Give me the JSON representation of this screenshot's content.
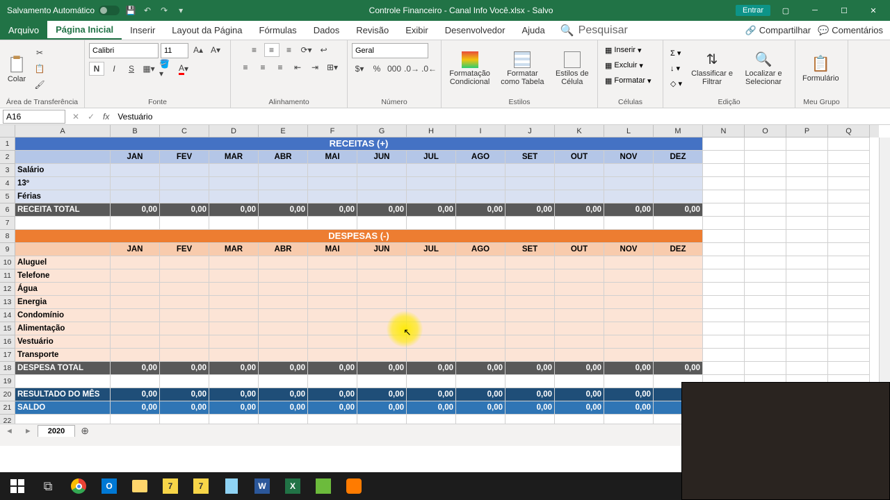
{
  "titlebar": {
    "auto_save": "Salvamento Automático",
    "title": "Controle Financeiro - Canal Info Você.xlsx - Salvo",
    "login": "Entrar"
  },
  "tabs": {
    "file": "Arquivo",
    "home": "Página Inicial",
    "insert": "Inserir",
    "layout": "Layout da Página",
    "formulas": "Fórmulas",
    "data": "Dados",
    "review": "Revisão",
    "view": "Exibir",
    "developer": "Desenvolvedor",
    "help": "Ajuda",
    "search": "Pesquisar",
    "share": "Compartilhar",
    "comments": "Comentários"
  },
  "ribbon": {
    "clipboard": {
      "paste": "Colar",
      "label": "Área de Transferência"
    },
    "font": {
      "name": "Calibri",
      "size": "11",
      "label": "Fonte"
    },
    "alignment": {
      "label": "Alinhamento"
    },
    "number": {
      "format": "Geral",
      "label": "Número"
    },
    "styles": {
      "cond": "Formatação Condicional",
      "table": "Formatar como Tabela",
      "cell": "Estilos de Célula",
      "label": "Estilos"
    },
    "cells": {
      "insert": "Inserir",
      "delete": "Excluir",
      "format": "Formatar",
      "label": "Células"
    },
    "editing": {
      "sort": "Classificar e Filtrar",
      "find": "Localizar e Selecionar",
      "label": "Edição"
    },
    "form": {
      "btn": "Formulário",
      "label": "Meu Grupo"
    }
  },
  "namebox": "A16",
  "formula": "Vestuário",
  "columns": [
    "A",
    "B",
    "C",
    "D",
    "E",
    "F",
    "G",
    "H",
    "I",
    "J",
    "K",
    "L",
    "M",
    "N",
    "O",
    "P",
    "Q"
  ],
  "months": [
    "JAN",
    "FEV",
    "MAR",
    "ABR",
    "MAI",
    "JUN",
    "JUL",
    "AGO",
    "SET",
    "OUT",
    "NOV",
    "DEZ"
  ],
  "sections": {
    "receitas_title": "RECEITAS (+)",
    "despesas_title": "DESPESAS (-)",
    "receitas_rows": [
      "Salário",
      "13º",
      "Férias"
    ],
    "receita_total": "RECEITA TOTAL",
    "despesas_rows": [
      "Aluguel",
      "Telefone",
      "Água",
      "Energia",
      "Condomínio",
      "Alimentação",
      "Vestuário",
      "Transporte"
    ],
    "despesa_total": "DESPESA TOTAL",
    "resultado": "RESULTADO DO MÊS",
    "saldo": "SALDO",
    "zero": "0,00"
  },
  "sheet": {
    "active": "2020"
  },
  "chart_data": null
}
